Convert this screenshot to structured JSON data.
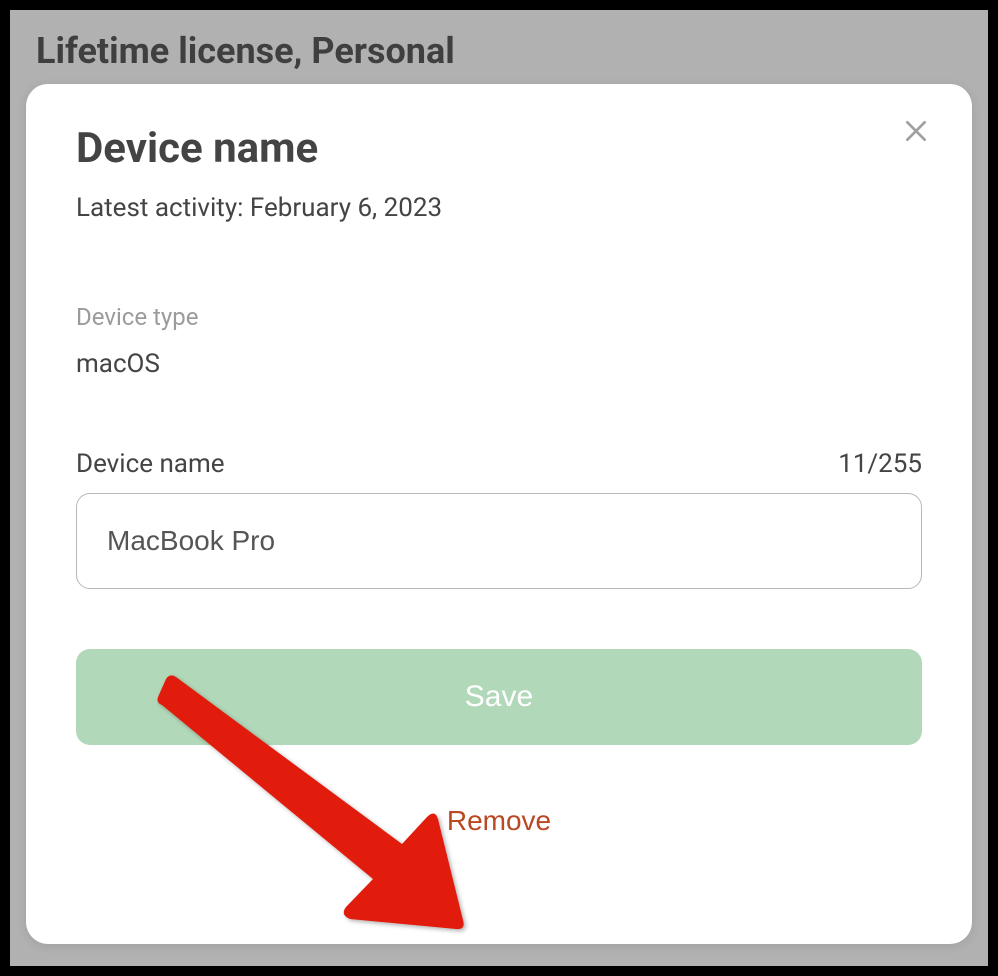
{
  "page": {
    "title": "Lifetime license, Personal"
  },
  "modal": {
    "title": "Device name",
    "latest_activity_label": "Latest activity: ",
    "latest_activity_date": "February 6, 2023",
    "device_type_label": "Device type",
    "device_type_value": "macOS",
    "device_name_label": "Device name",
    "char_count": "11/255",
    "device_name_value": "MacBook Pro",
    "save_label": "Save",
    "remove_label": "Remove"
  }
}
